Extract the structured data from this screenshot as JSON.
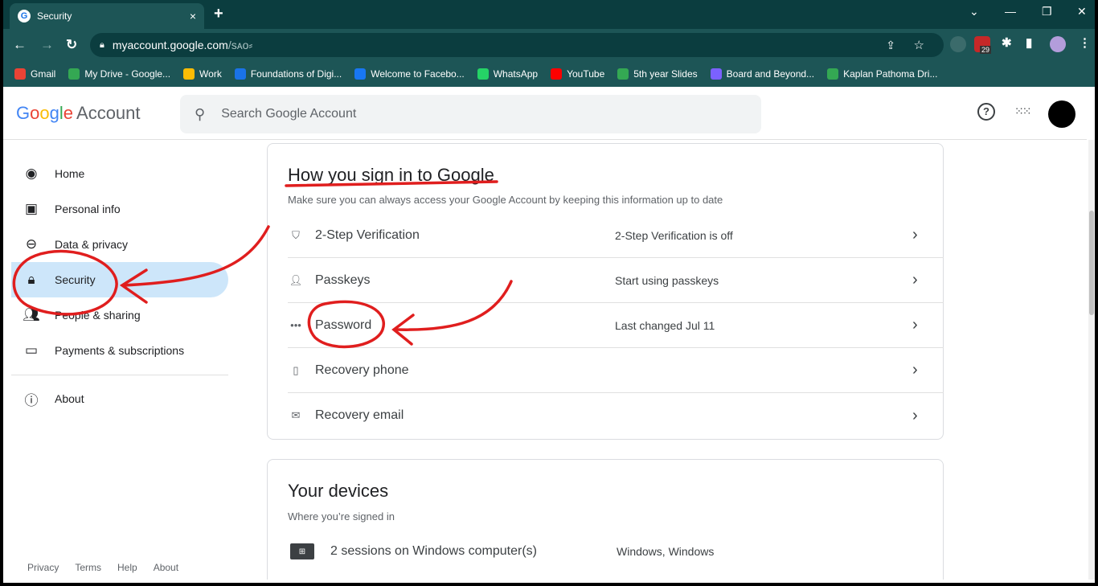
{
  "browser": {
    "tab_title": "Security",
    "tab_close": "×",
    "new_tab": "+",
    "url_host": "myaccount.google.com",
    "url_path": "/sᴀᴏ⸗",
    "bookmarks": [
      {
        "label": "Gmail",
        "color": "#ea4335"
      },
      {
        "label": "My Drive - Google...",
        "color": "#34a853"
      },
      {
        "label": "Work",
        "color": "#fbbc05"
      },
      {
        "label": "Foundations of Digi...",
        "color": "#1a73e8"
      },
      {
        "label": "Welcome to Facebo...",
        "color": "#1877f2"
      },
      {
        "label": "WhatsApp",
        "color": "#25d366"
      },
      {
        "label": "YouTube",
        "color": "#ff0000"
      },
      {
        "label": "5th year Slides",
        "color": "#34a853"
      },
      {
        "label": "Board and Beyond...",
        "color": "#7b61ff"
      },
      {
        "label": "Kaplan Pathoma Dri...",
        "color": "#34a853"
      }
    ],
    "ext_badge": "29"
  },
  "header": {
    "logo_letters": [
      "G",
      "o",
      "o",
      "g",
      "l",
      "e"
    ],
    "logo_suffix": "Account",
    "search_placeholder": "Search Google Account",
    "help_icon": "?",
    "apps_icon": "⋮⋮⋮"
  },
  "sidebar": {
    "items": [
      {
        "label": "Home",
        "icon": "account-circle-icon"
      },
      {
        "label": "Personal info",
        "icon": "id-card-icon"
      },
      {
        "label": "Data & privacy",
        "icon": "toggle-icon"
      },
      {
        "label": "Security",
        "icon": "lock-icon",
        "active": true
      },
      {
        "label": "People & sharing",
        "icon": "people-icon"
      },
      {
        "label": "Payments & subscriptions",
        "icon": "credit-card-icon"
      }
    ],
    "about": {
      "label": "About",
      "icon": "info-icon"
    },
    "footer": [
      "Privacy",
      "Terms",
      "Help",
      "About"
    ]
  },
  "signin": {
    "title": "How you sign in to Google",
    "subtitle": "Make sure you can always access your Google Account by keeping this information up to date",
    "rows": [
      {
        "label": "2-Step Verification",
        "value": "2-Step Verification is off",
        "icon": "shield-icon"
      },
      {
        "label": "Passkeys",
        "value": "Start using passkeys",
        "icon": "passkey-icon"
      },
      {
        "label": "Password",
        "value": "Last changed Jul 11",
        "icon": "password-dots-icon"
      },
      {
        "label": "Recovery phone",
        "value": "",
        "icon": "phone-icon"
      },
      {
        "label": "Recovery email",
        "value": "",
        "icon": "mail-icon"
      }
    ]
  },
  "devices": {
    "title": "Your devices",
    "subtitle": "Where you’re signed in",
    "sessions": {
      "label": "2 sessions on Windows computer(s)",
      "value": "Windows, Windows"
    }
  },
  "colors": {
    "active_nav": "#cde6fa",
    "annotation": "#e01e1e"
  }
}
